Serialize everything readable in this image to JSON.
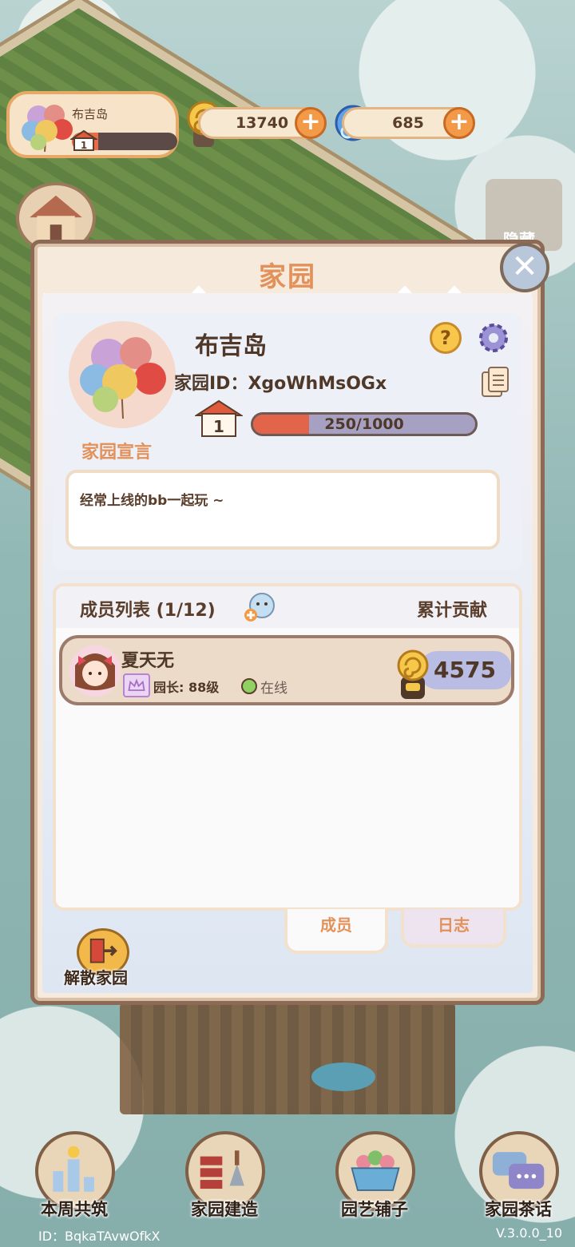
{
  "hud": {
    "home_name": "布吉岛",
    "home_level": "1",
    "home_progress": 0.25,
    "snail_coins": "13740",
    "snail_gems": "685"
  },
  "side": {
    "hide_label": "隐藏"
  },
  "dialog": {
    "title": "家园",
    "home_name": "布吉岛",
    "home_id_label": "家园ID：",
    "home_id": "XgoWhMsOGx",
    "level": "1",
    "exp_text": "250/1000",
    "exp_fraction": 0.25,
    "manifesto_label": "家园宣言",
    "manifesto_text": "经常上线的bb一起玩 ~",
    "members_title": "成员列表 (1/12)",
    "contribution_title": "累计贡献",
    "members": [
      {
        "name": "夏天无",
        "role": "园长: 88级",
        "status": "在线",
        "contribution": "4575"
      }
    ],
    "tabs": {
      "members": "成员",
      "log": "日志"
    },
    "disband_label": "解散家园"
  },
  "nav": [
    {
      "label": "本周共筑",
      "icon": "weekly-build-icon"
    },
    {
      "label": "家园建造",
      "icon": "bricks-trowel-icon"
    },
    {
      "label": "园艺铺子",
      "icon": "flower-basket-icon"
    },
    {
      "label": "家园茶话",
      "icon": "chat-bubbles-icon"
    }
  ],
  "footer": {
    "user_id": "ID：BqkaTAvwOfkX",
    "version": "V.3.0.0_10"
  },
  "colors": {
    "accent": "#e3915a",
    "progress": "#e2654a",
    "dialog_border": "#8d6a55"
  }
}
